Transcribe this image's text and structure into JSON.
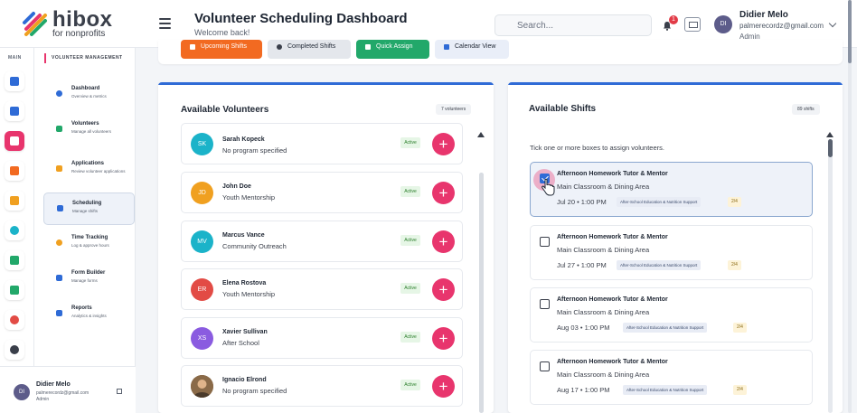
{
  "app": {
    "logo_main": "hibox",
    "logo_sub": "for nonprofits",
    "title": "Volunteer Scheduling Dashboard",
    "subtitle": "Welcome back!"
  },
  "header": {
    "search_placeholder": "Search...",
    "notification_count": "1",
    "user": {
      "initials": "DI",
      "name": "Didier Melo",
      "email": "palmerecordz@gmail.com",
      "role": "Admin"
    }
  },
  "rail": {
    "label": "MAIN"
  },
  "nav": {
    "section": "VOLUNTEER MANAGEMENT",
    "items": [
      {
        "label": "Dashboard",
        "desc": "Overview & metrics"
      },
      {
        "label": "Volunteers",
        "desc": "Manage all volunteers"
      },
      {
        "label": "Applications",
        "desc": "Review volunteer applications"
      },
      {
        "label": "Scheduling",
        "desc": "Manage shifts"
      },
      {
        "label": "Time Tracking",
        "desc": "Log & approve hours"
      },
      {
        "label": "Form Builder",
        "desc": "Manage forms"
      },
      {
        "label": "Reports",
        "desc": "Analytics & insights"
      }
    ]
  },
  "footer_user": {
    "initials": "DI",
    "name": "Didier Melo",
    "email": "palmerecordz@gmail.com",
    "role": "Admin"
  },
  "tabs": [
    {
      "label": "Upcoming Shifts"
    },
    {
      "label": "Completed Shifts"
    },
    {
      "label": "Quick Assign"
    },
    {
      "label": "Calendar View"
    }
  ],
  "volunteers_panel": {
    "title": "Available Volunteers",
    "count": "7 volunteers",
    "items": [
      {
        "initials": "SK",
        "name": "Sarah Kopeck",
        "program": "No program specified",
        "status": "Active",
        "color": "#1bb3c9"
      },
      {
        "initials": "JD",
        "name": "John Doe",
        "program": "Youth Mentorship",
        "status": "Active",
        "color": "#f0a020"
      },
      {
        "initials": "MV",
        "name": "Marcus Vance",
        "program": "Community Outreach",
        "status": "Active",
        "color": "#1bb3c9"
      },
      {
        "initials": "ER",
        "name": "Elena Rostova",
        "program": "Youth Mentorship",
        "status": "Active",
        "color": "#e24b45"
      },
      {
        "initials": "XS",
        "name": "Xavier Sullivan",
        "program": "After School",
        "status": "Active",
        "color": "#8a5be0"
      },
      {
        "initials": "",
        "name": "Ignacio Elrond",
        "program": "No program specified",
        "status": "Active",
        "color": "#7a5a3a"
      }
    ]
  },
  "shifts_panel": {
    "title": "Available Shifts",
    "count": "89 shifts",
    "hint": "Tick one or more boxes to assign volunteers.",
    "items": [
      {
        "title": "Afternoon Homework Tutor & Mentor",
        "location": "Main Classroom & Dining Area",
        "date": "Jul 20 • 1:00 PM",
        "tag": "After-School Education & Nutrition Support",
        "capacity": "2/4",
        "checked": true
      },
      {
        "title": "Afternoon Homework Tutor & Mentor",
        "location": "Main Classroom & Dining Area",
        "date": "Jul 27 • 1:00 PM",
        "tag": "After-School Education & Nutrition Support",
        "capacity": "2/4",
        "checked": false
      },
      {
        "title": "Afternoon Homework Tutor & Mentor",
        "location": "Main Classroom & Dining Area",
        "date": "Aug 03 • 1:00 PM",
        "tag": "After-School Education & Nutrition Support",
        "capacity": "2/4",
        "checked": false
      },
      {
        "title": "Afternoon Homework Tutor & Mentor",
        "location": "Main Classroom & Dining Area",
        "date": "Aug 17 • 1:00 PM",
        "tag": "After-School Education & Nutrition Support",
        "capacity": "2/4",
        "checked": false
      }
    ]
  },
  "colors": {
    "accent": "#e8356d",
    "primary": "#2f6bd6",
    "upcoming_tab": "#f26a21",
    "quick_assign_tab": "#22a86a"
  }
}
